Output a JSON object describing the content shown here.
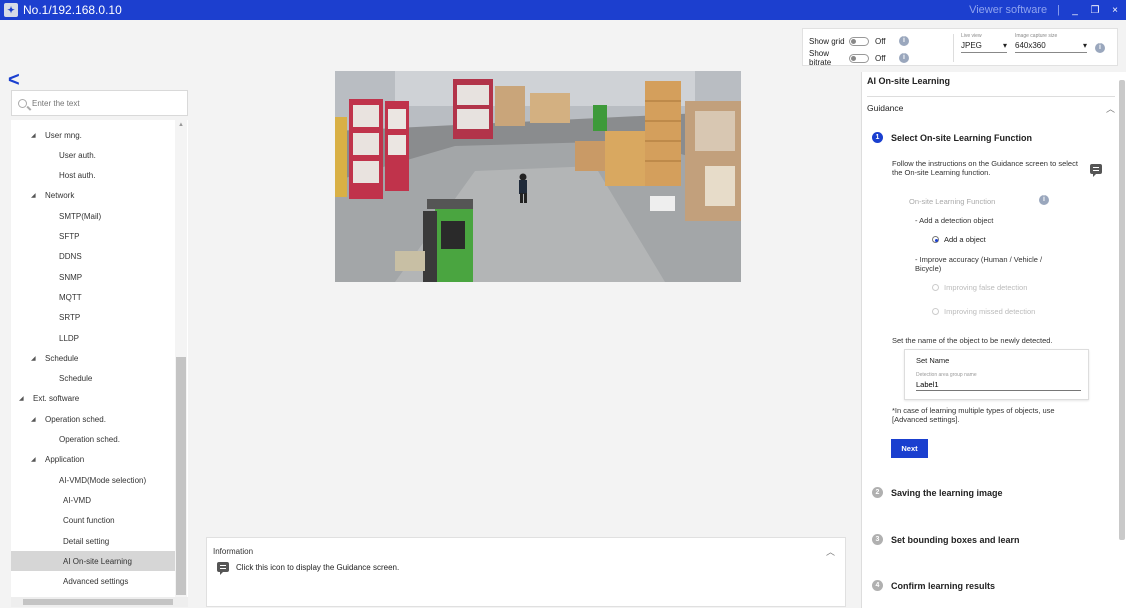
{
  "titlebar": {
    "title": "No.1/192.168.0.10",
    "viewer": "Viewer software",
    "separator": "|",
    "minimize": "_",
    "restore": "❐",
    "close": "×"
  },
  "top_controls": {
    "show_grid": {
      "label": "Show grid",
      "state": "Off"
    },
    "show_bitrate": {
      "label": "Show bitrate",
      "state": "Off"
    },
    "live_view": {
      "label": "Live view",
      "value": "JPEG"
    },
    "image_capture_size": {
      "label": "Image capture size",
      "value": "640x360"
    }
  },
  "sidebar": {
    "search_placeholder": "Enter the text",
    "items": [
      {
        "label": "User mng.",
        "level": 1,
        "expandable": true
      },
      {
        "label": "User auth.",
        "level": 2
      },
      {
        "label": "Host auth.",
        "level": 2
      },
      {
        "label": "Network",
        "level": 1,
        "expandable": true
      },
      {
        "label": "SMTP(Mail)",
        "level": 2
      },
      {
        "label": "SFTP",
        "level": 2
      },
      {
        "label": "DDNS",
        "level": 2
      },
      {
        "label": "SNMP",
        "level": 2
      },
      {
        "label": "MQTT",
        "level": 2
      },
      {
        "label": "SRTP",
        "level": 2
      },
      {
        "label": "LLDP",
        "level": 2
      },
      {
        "label": "Schedule",
        "level": 1,
        "expandable": true
      },
      {
        "label": "Schedule",
        "level": 2
      },
      {
        "label": "Ext. software",
        "level": 0,
        "expandable": true
      },
      {
        "label": "Operation sched.",
        "level": 1,
        "expandable": true
      },
      {
        "label": "Operation sched.",
        "level": 2
      },
      {
        "label": "Application",
        "level": 1,
        "expandable": true
      },
      {
        "label": "AI-VMD(Mode selection)",
        "level": 2
      },
      {
        "label": "AI-VMD",
        "level": 3
      },
      {
        "label": "Count function",
        "level": 3
      },
      {
        "label": "Detail setting",
        "level": 3
      },
      {
        "label": "AI On-site Learning",
        "level": 3,
        "selected": true
      },
      {
        "label": "Advanced settings",
        "level": 3
      }
    ]
  },
  "information": {
    "header": "Information",
    "message": "Click this icon to display the Guidance screen."
  },
  "right_panel": {
    "title": "AI On-site Learning",
    "guidance": "Guidance",
    "steps": [
      {
        "num": "1",
        "label": "Select On-site Learning Function"
      },
      {
        "num": "2",
        "label": "Saving the learning image"
      },
      {
        "num": "3",
        "label": "Set bounding boxes and learn"
      },
      {
        "num": "4",
        "label": "Confirm learning results"
      }
    ],
    "instruction": "Follow the instructions on the Guidance screen to select the On-site Learning function.",
    "feature_label": "On-site Learning Function",
    "add_detection": "- Add a detection object",
    "add_object": "Add a object",
    "improve_accuracy": "- Improve accuracy (Human / Vehicle / Bicycle)",
    "improve_false": "Improving false detection",
    "improve_missed": "Improving missed detection",
    "set_name_prompt": "Set the name of the object to be newly detected.",
    "set_name": {
      "title": "Set Name",
      "field_label": "Detection area group name",
      "value": "Label1"
    },
    "note": "*In case of learning multiple types of objects, use [Advanced settings].",
    "next": "Next"
  }
}
